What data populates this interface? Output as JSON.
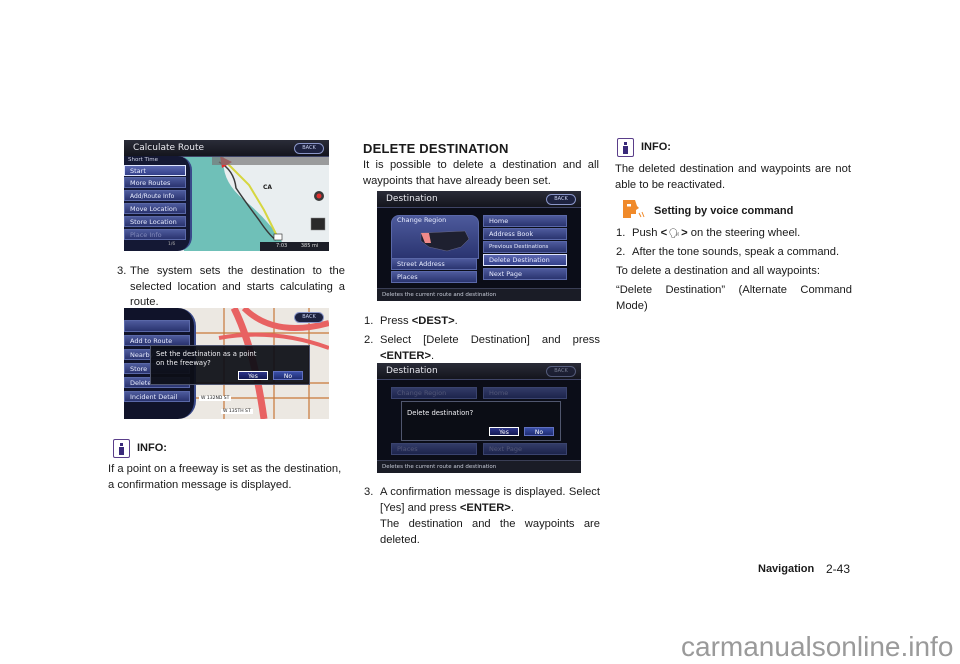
{
  "column1": {
    "screen_calculate_route": {
      "title": "Calculate Route",
      "back_label": "BACK",
      "route_type": "Short Time",
      "menu": [
        "Start",
        "More Routes",
        "Add/Route Info",
        "Move Location",
        "Store Location",
        "Place Info"
      ],
      "page_indicator": "1/6",
      "map_label_state": "CA",
      "status_time": "7:03",
      "status_distance": "385 mi"
    },
    "step3": {
      "num": "3.",
      "text": "The system sets the destination to the selected location and starts calculating a route."
    },
    "screen_freeway": {
      "back_label": "BACK",
      "menu": [
        "Add to Route",
        "Nearby",
        "Store",
        "Delete",
        "Incident Detail"
      ],
      "dialog_message": "Set the destination as a point on the freeway?",
      "yes_label": "Yes",
      "no_label": "No",
      "street_labels": [
        "W 132ND ST",
        "W 135TH ST"
      ]
    },
    "info": {
      "label": "INFO:",
      "text": "If a point on a freeway is set as the destination, a confirmation message is displayed."
    }
  },
  "column2": {
    "heading": "DELETE DESTINATION",
    "intro": "It is possible to delete a destination and all waypoints that have already been set.",
    "screen_destination": {
      "title": "Destination",
      "back_label": "BACK",
      "left_menu": [
        "Change Region",
        "Street Address",
        "Places"
      ],
      "right_menu": [
        "Home",
        "Address Book",
        "Previous Destinations",
        "Delete Destination",
        "Next Page"
      ],
      "footer": "Deletes the current route and destination"
    },
    "steps": [
      {
        "num": "1.",
        "prefix": "Press ",
        "key": "<DEST>",
        "suffix": "."
      },
      {
        "num": "2.",
        "prefix": "Select [Delete Destination] and press ",
        "key": "<ENTER>",
        "suffix": "."
      }
    ],
    "screen_delete_confirm": {
      "title": "Destination",
      "back_label": "BACK",
      "bg_items": [
        "Change Region",
        "Home",
        "Places",
        "Next Page"
      ],
      "dialog_message": "Delete destination?",
      "yes_label": "Yes",
      "no_label": "No",
      "footer": "Deletes the current route and destination"
    },
    "step3": {
      "num": "3.",
      "prefix": "A confirmation message is displayed. Select [Yes] and press ",
      "key": "<ENTER>",
      "suffix": ".",
      "result": "The destination and the waypoints are deleted."
    }
  },
  "column3": {
    "info": {
      "label": "INFO:",
      "text": "The deleted destination and waypoints are not able to be reactivated."
    },
    "voice": {
      "heading": "Setting by voice command",
      "steps": [
        {
          "num": "1.",
          "prefix": "Push ",
          "key_open": "<",
          "key_close": ">",
          "suffix": " on the steering wheel."
        },
        {
          "num": "2.",
          "text": "After the tone sounds, speak a command."
        }
      ],
      "instruction": "To delete a destination and all waypoints:",
      "command": "“Delete Destination” (Alternate Command Mode)"
    }
  },
  "footer": {
    "section": "Navigation",
    "page": "2-43",
    "watermark": "carmanualsonline.info"
  },
  "colors": {
    "info_icon": "#5a3e8a",
    "voice_icon": "#f08a2a",
    "menu_blue": "#3a4590",
    "watermark": "#9a9a9a"
  }
}
